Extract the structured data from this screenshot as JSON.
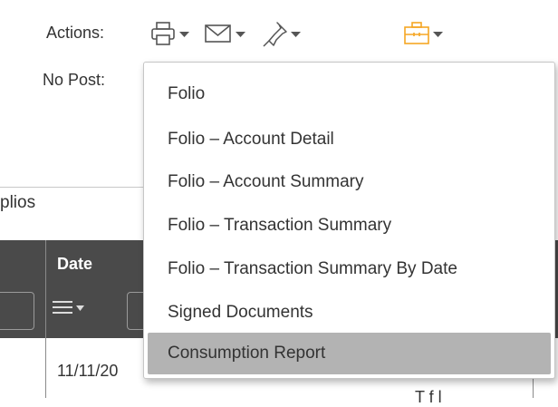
{
  "header": {
    "top_cut_text": "",
    "actions_label": "Actions:",
    "nopost_label": "No Post:",
    "icons": [
      {
        "name": "print-icon",
        "color": "#555555"
      },
      {
        "name": "mail-icon",
        "color": "#555555"
      },
      {
        "name": "pin-icon",
        "color": "#555555"
      },
      {
        "name": "briefcase-icon",
        "color": "#f5a623"
      }
    ]
  },
  "menu": {
    "items": [
      {
        "label": "Folio",
        "active": false
      },
      {
        "label": "Folio – Account Detail",
        "active": false
      },
      {
        "label": "Folio – Account Summary",
        "active": false
      },
      {
        "label": "Folio – Transaction Summary",
        "active": false
      },
      {
        "label": "Folio – Transaction Summary By Date",
        "active": false
      },
      {
        "label": "Signed Documents",
        "active": false
      },
      {
        "label": "Consumption Report",
        "active": true
      }
    ]
  },
  "table": {
    "section_label": "plios",
    "date_header": "Date",
    "first_date": "11/11/20",
    "right_cut_text": "T     f    l"
  },
  "colors": {
    "header_bg": "#4a4a4a",
    "active_item_bg": "#b3b3b3",
    "accent_orange": "#f5a623"
  }
}
